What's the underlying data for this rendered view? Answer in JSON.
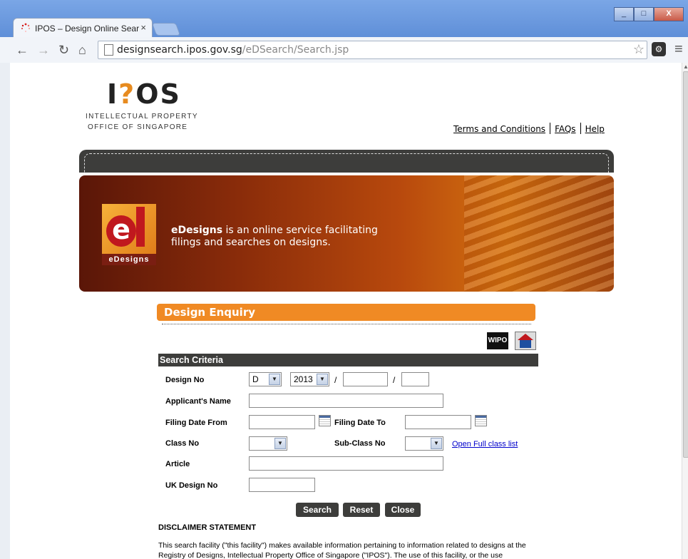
{
  "browser": {
    "tab_title": "IPOS – Design Online Sear",
    "tab_close": "×",
    "url_host": "designsearch.ipos.gov.sg",
    "url_path": "/eDSearch/Search.jsp",
    "star": "☆",
    "back": "←",
    "forward": "→",
    "reload": "↻",
    "home": "⌂",
    "menu": "≡",
    "win_min": "_",
    "win_max": "□",
    "win_close": "X"
  },
  "logo": {
    "mark_i": "I",
    "mark_q": "?",
    "mark_os": "OS",
    "line1": "INTELLECTUAL PROPERTY",
    "line2": "OFFICE OF SINGAPORE"
  },
  "top_links": [
    "Terms and Conditions",
    "FAQs",
    "Help"
  ],
  "banner": {
    "logo_caption": "eDesigns",
    "logo_letter_e": "e",
    "tag_bold": "eDesigns",
    "tag_rest": " is an online service facilitating",
    "tag_line2": "filings and searches on designs."
  },
  "enquiry": {
    "title": "Design Enquiry",
    "wipo": "WIPO",
    "criteria_header": "Search Criteria"
  },
  "form": {
    "design_no_label": "Design No",
    "design_no_prefix": "D",
    "design_no_year": "2013",
    "slash": "/",
    "applicant_label": "Applicant's Name",
    "filing_from_label": "Filing Date From",
    "filing_to_label": "Filing Date To",
    "class_label": "Class No",
    "subclass_label": "Sub-Class No",
    "full_class_link": "Open Full class list",
    "article_label": "Article",
    "uk_design_label": "UK Design No"
  },
  "buttons": {
    "search": "Search",
    "reset": "Reset",
    "close": "Close"
  },
  "disclaimer": {
    "title": "DISCLAIMER STATEMENT",
    "text": "This search facility (\"this facility\") makes available information pertaining to information related to designs at the Registry of Designs, Intellectual Property Office of Singapore (\"IPOS\"). The use of this facility, or the use"
  },
  "colors": {
    "accent_orange": "#f08a24",
    "dark_band": "#3d3d3b",
    "link_blue": "#0000cc"
  }
}
